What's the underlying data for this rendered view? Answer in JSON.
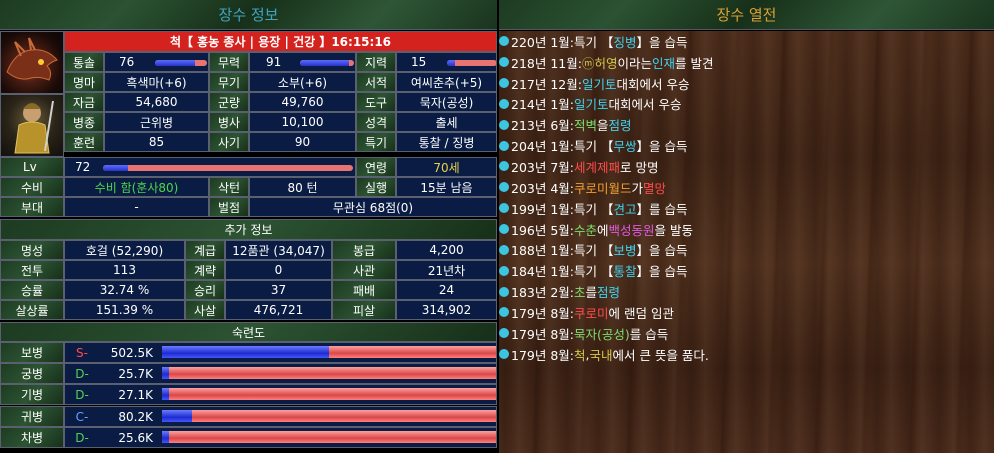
{
  "left_header": "장수 정보",
  "right_header": "장수 열전",
  "general": {
    "title": "척【 홍농 종사 | 용장 | 건강 】16:15:16",
    "stats": [
      {
        "label": "통솔",
        "value": "76",
        "bar": 0.76
      },
      {
        "label": "무력",
        "value": "91",
        "bar": 0.91
      },
      {
        "label": "지력",
        "value": "15",
        "bar": 0.15
      }
    ],
    "row2": [
      {
        "label": "명마",
        "value": "흑색마(+6)"
      },
      {
        "label": "무기",
        "value": "소부(+6)"
      },
      {
        "label": "서적",
        "value": "여씨춘추(+5)"
      }
    ],
    "row3": [
      {
        "label": "자금",
        "value": "54,680"
      },
      {
        "label": "군량",
        "value": "49,760"
      },
      {
        "label": "도구",
        "value": "묵자(공성)"
      }
    ],
    "row4": [
      {
        "label": "병종",
        "value": "근위병"
      },
      {
        "label": "병사",
        "value": "10,100"
      },
      {
        "label": "성격",
        "value": "출세"
      }
    ],
    "row5": [
      {
        "label": "훈련",
        "value": "85"
      },
      {
        "label": "사기",
        "value": "90"
      },
      {
        "label": "특기",
        "value": "통찰 / 징병"
      }
    ],
    "lv": {
      "label": "Lv",
      "value": "72",
      "bar": 0.1
    },
    "age": {
      "label": "연령",
      "value": "70세"
    },
    "defense": {
      "label": "수비",
      "value": "수비 함(훈사80)"
    },
    "turn": {
      "label": "삭턴",
      "value": "80 턴"
    },
    "exec": {
      "label": "실행",
      "value": "15분 남음"
    },
    "unit": {
      "label": "부대",
      "value": "-"
    },
    "penalty": {
      "label": "벌점",
      "value": "무관심 68점(0)"
    }
  },
  "extra_header": "추가 정보",
  "extra": [
    [
      {
        "label": "명성",
        "value": "호걸 (52,290)"
      },
      {
        "label": "계급",
        "value": "12품관 (34,047)"
      },
      {
        "label": "봉급",
        "value": "4,200"
      }
    ],
    [
      {
        "label": "전투",
        "value": "113"
      },
      {
        "label": "계략",
        "value": "0"
      },
      {
        "label": "사관",
        "value": "21년차"
      }
    ],
    [
      {
        "label": "승률",
        "value": "32.74 %"
      },
      {
        "label": "승리",
        "value": "37"
      },
      {
        "label": "패배",
        "value": "24"
      }
    ],
    [
      {
        "label": "살상률",
        "value": "151.39 %"
      },
      {
        "label": "사살",
        "value": "476,721"
      },
      {
        "label": "피살",
        "value": "314,902"
      }
    ]
  ],
  "skill_header": "숙련도",
  "skills": [
    {
      "label": "보병",
      "grade": "S-",
      "grade_color": "#ff4b4b",
      "value": "502.5K",
      "bar": 0.5
    },
    {
      "label": "궁병",
      "grade": "D-",
      "grade_color": "#4bd64b",
      "value": "25.7K",
      "bar": 0.02
    },
    {
      "label": "기병",
      "grade": "D-",
      "grade_color": "#4bd64b",
      "value": "27.1K",
      "bar": 0.02
    },
    {
      "label": "귀병",
      "grade": "C-",
      "grade_color": "#6aa0ff",
      "value": "80.2K",
      "bar": 0.09
    },
    {
      "label": "차병",
      "grade": "D-",
      "grade_color": "#4bd64b",
      "value": "25.6K",
      "bar": 0.02
    }
  ],
  "history": [
    [
      {
        "t": "220년 1월:특기 【"
      },
      {
        "t": "징병",
        "c": "c-cyan"
      },
      {
        "t": "】을 습득"
      }
    ],
    [
      {
        "t": "218년 11월:"
      },
      {
        "t": "ⓜ",
        "c": "c-yel"
      },
      {
        "t": "허영",
        "c": "c-yel"
      },
      {
        "t": "이라는 "
      },
      {
        "t": "인재",
        "c": "c-cyan"
      },
      {
        "t": "를 발견"
      }
    ],
    [
      {
        "t": "217년 12월:"
      },
      {
        "t": "일기토",
        "c": "c-cyan"
      },
      {
        "t": " 대회에서 우승"
      }
    ],
    [
      {
        "t": "214년 1월:"
      },
      {
        "t": "일기토",
        "c": "c-cyan"
      },
      {
        "t": " 대회에서 우승"
      }
    ],
    [
      {
        "t": "213년 6월:"
      },
      {
        "t": "적벽",
        "c": "c-lgreen"
      },
      {
        "t": "을 "
      },
      {
        "t": "점령",
        "c": "c-cyan"
      }
    ],
    [
      {
        "t": "204년 1월:특기 【"
      },
      {
        "t": "무쌍",
        "c": "c-cyan"
      },
      {
        "t": "】을 습득"
      }
    ],
    [
      {
        "t": "203년 7월:"
      },
      {
        "t": "세계제패",
        "c": "c-red"
      },
      {
        "t": "로 망명"
      }
    ],
    [
      {
        "t": "203년 4월:"
      },
      {
        "t": "쿠로미월드",
        "c": "c-orange"
      },
      {
        "t": "가 "
      },
      {
        "t": "멸망",
        "c": "c-red"
      }
    ],
    [
      {
        "t": "199년 1월:특기 【"
      },
      {
        "t": "견고",
        "c": "c-cyan"
      },
      {
        "t": "】를 습득"
      }
    ],
    [
      {
        "t": "196년 5월:"
      },
      {
        "t": "수춘",
        "c": "c-lgreen"
      },
      {
        "t": "에 "
      },
      {
        "t": "백성동원",
        "c": "c-mag"
      },
      {
        "t": "을 발동"
      }
    ],
    [
      {
        "t": "188년 1월:특기 【"
      },
      {
        "t": "보병",
        "c": "c-cyan"
      },
      {
        "t": "】을 습득"
      }
    ],
    [
      {
        "t": "184년 1월:특기 【"
      },
      {
        "t": "통찰",
        "c": "c-cyan"
      },
      {
        "t": "】을 습득"
      }
    ],
    [
      {
        "t": "183년 2월:"
      },
      {
        "t": "초",
        "c": "c-lgreen"
      },
      {
        "t": "를 "
      },
      {
        "t": "점령",
        "c": "c-cyan"
      }
    ],
    [
      {
        "t": "179년 8월:"
      },
      {
        "t": "쿠로미",
        "c": "c-red"
      },
      {
        "t": "에 랜덤 임관"
      }
    ],
    [
      {
        "t": "179년 8월:"
      },
      {
        "t": "묵자(공성)",
        "c": "c-lgreen"
      },
      {
        "t": "를 습득"
      }
    ],
    [
      {
        "t": "179년 8월:"
      },
      {
        "t": "척",
        "c": "c-yel"
      },
      {
        "t": ", "
      },
      {
        "t": "국내",
        "c": "c-yel"
      },
      {
        "t": "에서 큰 뜻을 품다."
      }
    ]
  ]
}
